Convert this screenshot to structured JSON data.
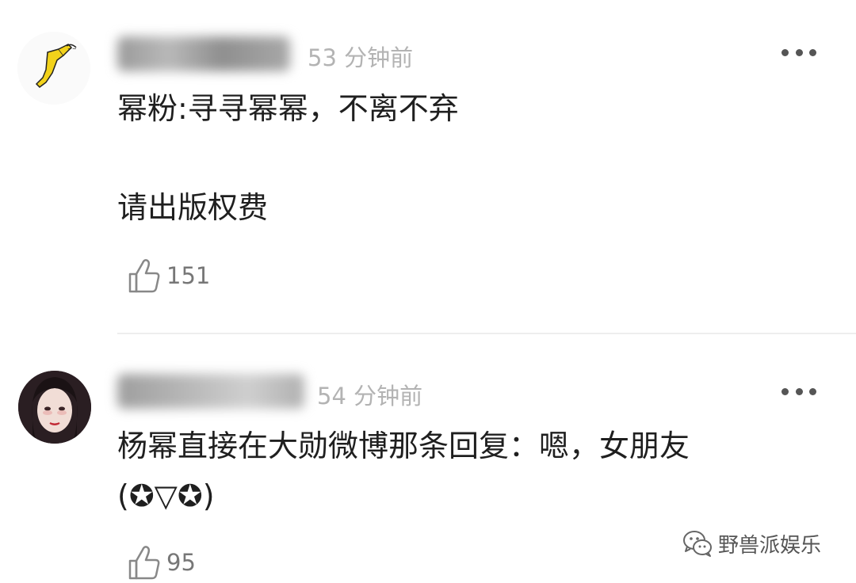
{
  "comments": [
    {
      "time": "53 分钟前",
      "lines": [
        "幂粉:寻寻幂幂，不离不弃",
        "请出版权费"
      ],
      "likes": "151"
    },
    {
      "time": "54 分钟前",
      "lines": [
        "杨幂直接在大勋微博那条回复：嗯，女朋友",
        "(✪▽✪)"
      ],
      "likes": "95"
    }
  ],
  "watermark": {
    "label": "野兽派娱乐"
  },
  "colors": {
    "text": "#1f1f1f",
    "meta": "#b3b3b3",
    "icon": "#777777"
  }
}
